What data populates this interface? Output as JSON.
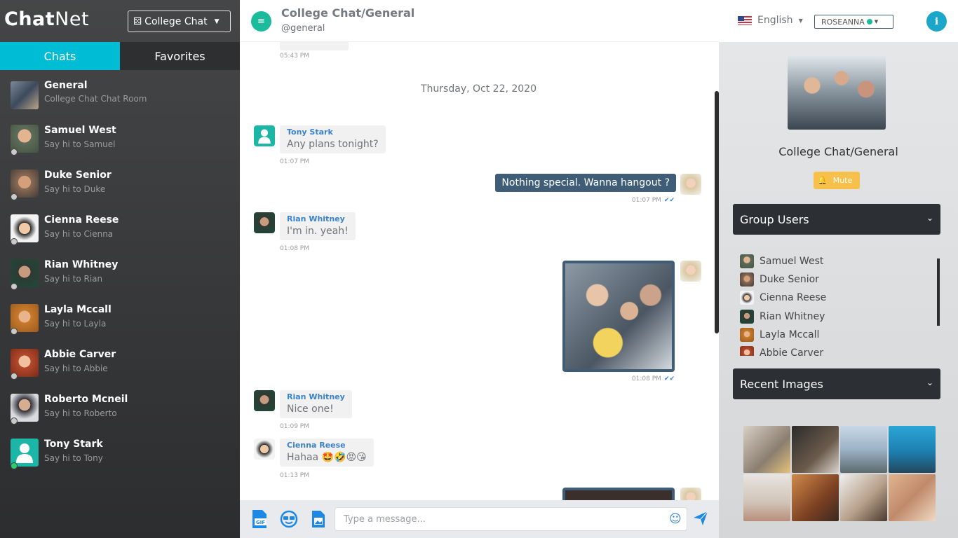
{
  "brand": {
    "bold": "Chat",
    "regular": "Net"
  },
  "room_selector": {
    "label": "College Chat"
  },
  "tabs": {
    "chats": "Chats",
    "favorites": "Favorites"
  },
  "chats": [
    {
      "name": "General",
      "subtitle": "College Chat Chat Room",
      "avatar": "general"
    },
    {
      "name": "Samuel West",
      "subtitle": "Say hi to Samuel",
      "avatar": "samuel"
    },
    {
      "name": "Duke Senior",
      "subtitle": "Say hi to Duke",
      "avatar": "duke"
    },
    {
      "name": "Cienna Reese",
      "subtitle": "Say hi to Cienna",
      "avatar": "cienna"
    },
    {
      "name": "Rian Whitney",
      "subtitle": "Say hi to Rian",
      "avatar": "rian"
    },
    {
      "name": "Layla Mccall",
      "subtitle": "Say hi to Layla",
      "avatar": "layla"
    },
    {
      "name": "Abbie Carver",
      "subtitle": "Say hi to Abbie",
      "avatar": "abbie"
    },
    {
      "name": "Roberto Mcneil",
      "subtitle": "Say hi to Roberto",
      "avatar": "roberto"
    },
    {
      "name": "Tony Stark",
      "subtitle": "Say hi to Tony",
      "avatar": "tony"
    }
  ],
  "header": {
    "title": "College Chat/General",
    "handle": "@general"
  },
  "messages": {
    "top_partial_time": "05:43 PM",
    "date": "Thursday, Oct 22, 2020",
    "m1": {
      "sender": "Tony Stark",
      "text": "Any plans tonight?",
      "time": "01:07 PM"
    },
    "m2": {
      "text": "Nothing special. Wanna hangout ?",
      "time": "01:07 PM"
    },
    "m3": {
      "sender": "Rian Whitney",
      "text": "I'm in. yeah!",
      "time": "01:08 PM"
    },
    "m4": {
      "time": "01:08 PM"
    },
    "m5": {
      "sender": "Rian Whitney",
      "text": "Nice one!",
      "time": "01:09 PM"
    },
    "m6": {
      "sender": "Cienna Reese",
      "text": "Hahaa 🤩🤣😡😘",
      "time": "01:13 PM"
    }
  },
  "composer": {
    "placeholder": "Type a message..."
  },
  "topbar": {
    "language": "English",
    "username": "ROSEANNA"
  },
  "panel": {
    "title": "College Chat/General",
    "mute": "Mute",
    "group_users_title": "Group Users",
    "recent_images_title": "Recent Images",
    "users": [
      "Samuel West",
      "Duke Senior",
      "Cienna Reese",
      "Rian Whitney",
      "Layla Mccall",
      "Abbie Carver"
    ]
  },
  "colors": {
    "accent": "#00bcd4",
    "outgoing": "#3f5d76",
    "sender_name": "#3b83c9",
    "mute": "#f7c04a"
  }
}
